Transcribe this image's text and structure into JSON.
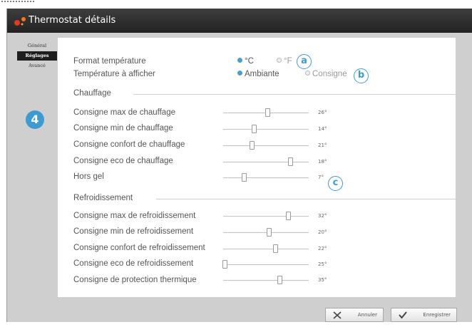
{
  "window": {
    "title": "Thermostat détails"
  },
  "tabs": [
    {
      "label": "Général",
      "active": false
    },
    {
      "label": "Réglages",
      "active": true
    },
    {
      "label": "Avancé",
      "active": false
    }
  ],
  "badges": {
    "step": "4",
    "a": "a",
    "b": "b",
    "c": "c"
  },
  "format": {
    "label": "Format température",
    "options": [
      {
        "label": "°C",
        "selected": true
      },
      {
        "label": "°F",
        "selected": false
      }
    ]
  },
  "display": {
    "label": "Température à afficher",
    "options": [
      {
        "label": "Ambiante",
        "selected": true
      },
      {
        "label": "Consigne",
        "selected": false
      }
    ]
  },
  "heating": {
    "title": "Chauffage",
    "rows": [
      {
        "label": "Consigne max de chauffage",
        "value": "26°",
        "level": 0.52
      },
      {
        "label": "Consigne min de chauffage",
        "value": "14°",
        "level": 0.36
      },
      {
        "label": "Consigne confort de chauffage",
        "value": "21°",
        "level": 0.33
      },
      {
        "label": "Consigne eco de chauffage",
        "value": "18°",
        "level": 0.78
      },
      {
        "label": "Hors gel",
        "value": "7°",
        "level": 0.24
      }
    ]
  },
  "cooling": {
    "title": "Refroidissement",
    "rows": [
      {
        "label": "Consigne max de refroidissement",
        "value": "32°",
        "level": 0.76
      },
      {
        "label": "Consigne min de refroidissement",
        "value": "20°",
        "level": 0.53
      },
      {
        "label": "Consigne confort de refroidissement",
        "value": "22°",
        "level": 0.61
      },
      {
        "label": "Consigne eco de refroidissement",
        "value": "25°",
        "level": 0.02
      },
      {
        "label": "Consigne de protection thermique",
        "value": "35°",
        "level": 0.66
      }
    ]
  },
  "buttons": {
    "cancel": "Annuler",
    "save": "Enregistrer"
  },
  "colors": {
    "accent": "#3d9bd3",
    "logo": "#e23a1f",
    "titlebar": "#2b2b2b"
  }
}
